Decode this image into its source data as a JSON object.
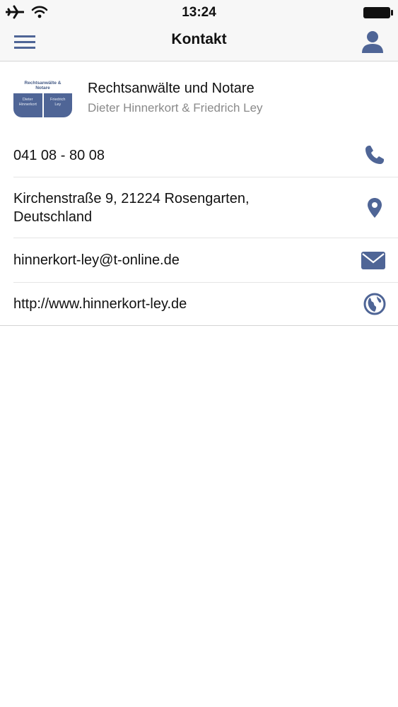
{
  "status_bar": {
    "time": "13:24",
    "icons": [
      "airplane-icon",
      "wifi-icon",
      "battery-icon"
    ]
  },
  "nav": {
    "title": "Kontakt",
    "left_icon": "hamburger-menu-icon",
    "right_icon": "person-icon"
  },
  "company": {
    "name": "Rechtsanwälte und Notare",
    "subtitle": "Dieter Hinnerkort & Friedrich Ley",
    "logo": {
      "top_line1": "Rechtsanwälte &",
      "top_line2": "Notare",
      "left_line1": "Dieter",
      "left_line2": "Hinnerkort",
      "right_line1": "Friedrich",
      "right_line2": "Ley"
    }
  },
  "contacts": {
    "phone": "041 08 - 80 08",
    "address_line1": "Kirchenstraße 9, 21224 Rosengarten,",
    "address_line2": "Deutschland",
    "email": "hinnerkort-ley@t-online.de",
    "website": "http://www.hinnerkort-ley.de"
  },
  "colors": {
    "accent": "#4f6596",
    "bar_background": "#f7f7f7",
    "secondary_text": "#8a8a8a"
  }
}
